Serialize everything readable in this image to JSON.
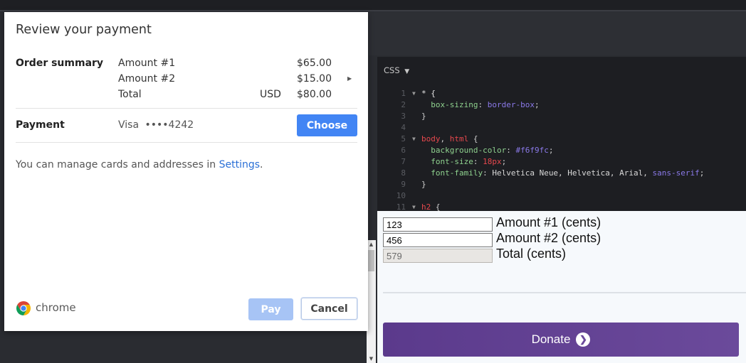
{
  "dialog": {
    "title": "Review your payment",
    "order_summary_label": "Order summary",
    "items": [
      {
        "label": "Amount #1",
        "amount": "$65.00"
      },
      {
        "label": "Amount #2",
        "amount": "$15.00"
      }
    ],
    "total": {
      "label": "Total",
      "currency": "USD",
      "amount": "$80.00"
    },
    "payment_label": "Payment",
    "card_brand": "Visa",
    "card_mask": "••••4242",
    "choose_label": "Choose",
    "manage_text": "You can manage cards and addresses in",
    "settings_link": "Settings",
    "manage_end": ".",
    "brand_word": "chrome",
    "pay_label": "Pay",
    "cancel_label": "Cancel"
  },
  "editor": {
    "header": "CSS",
    "lines": [
      {
        "n": "1",
        "fold": true,
        "seg": [
          [
            "* {",
            "c-sel"
          ]
        ]
      },
      {
        "n": "2",
        "fold": false,
        "seg": [
          [
            "  box-sizing",
            "c-prop"
          ],
          [
            ": ",
            "c-punc"
          ],
          [
            "border-box",
            "c-val"
          ],
          [
            ";",
            "c-punc"
          ]
        ]
      },
      {
        "n": "3",
        "fold": false,
        "seg": [
          [
            "}",
            "c-punc"
          ]
        ]
      },
      {
        "n": "4",
        "fold": false,
        "seg": []
      },
      {
        "n": "5",
        "fold": true,
        "seg": [
          [
            "body",
            "c-tag"
          ],
          [
            ", ",
            "c-punc"
          ],
          [
            "html",
            "c-tag"
          ],
          [
            " {",
            "c-punc"
          ]
        ]
      },
      {
        "n": "6",
        "fold": false,
        "seg": [
          [
            "  background-color",
            "c-prop"
          ],
          [
            ": ",
            "c-punc"
          ],
          [
            "#f6f9fc",
            "c-val"
          ],
          [
            ";",
            "c-punc"
          ]
        ]
      },
      {
        "n": "7",
        "fold": false,
        "seg": [
          [
            "  font-size",
            "c-prop"
          ],
          [
            ": ",
            "c-punc"
          ],
          [
            "18px",
            "c-num"
          ],
          [
            ";",
            "c-punc"
          ]
        ]
      },
      {
        "n": "8",
        "fold": false,
        "seg": [
          [
            "  font-family",
            "c-prop"
          ],
          [
            ": ",
            "c-punc"
          ],
          [
            "Helvetica Neue, Helvetica, Arial, ",
            "c-font"
          ],
          [
            "sans-serif",
            "c-val"
          ],
          [
            ";",
            "c-punc"
          ]
        ]
      },
      {
        "n": "9",
        "fold": false,
        "seg": [
          [
            "}",
            "c-punc"
          ]
        ]
      },
      {
        "n": "10",
        "fold": false,
        "seg": []
      },
      {
        "n": "11",
        "fold": true,
        "seg": [
          [
            "h2",
            "c-tag"
          ],
          [
            " {",
            "c-punc"
          ]
        ]
      }
    ]
  },
  "preview": {
    "amount1": {
      "value": "123",
      "label": "Amount #1 (cents)"
    },
    "amount2": {
      "value": "456",
      "label": "Amount #2 (cents)"
    },
    "total": {
      "value": "579",
      "label": "Total (cents)"
    },
    "donate_label": "Donate"
  },
  "colors": {
    "accent": "#4285f4",
    "donate": "#5b3a8c",
    "link": "#2a6fd6"
  }
}
